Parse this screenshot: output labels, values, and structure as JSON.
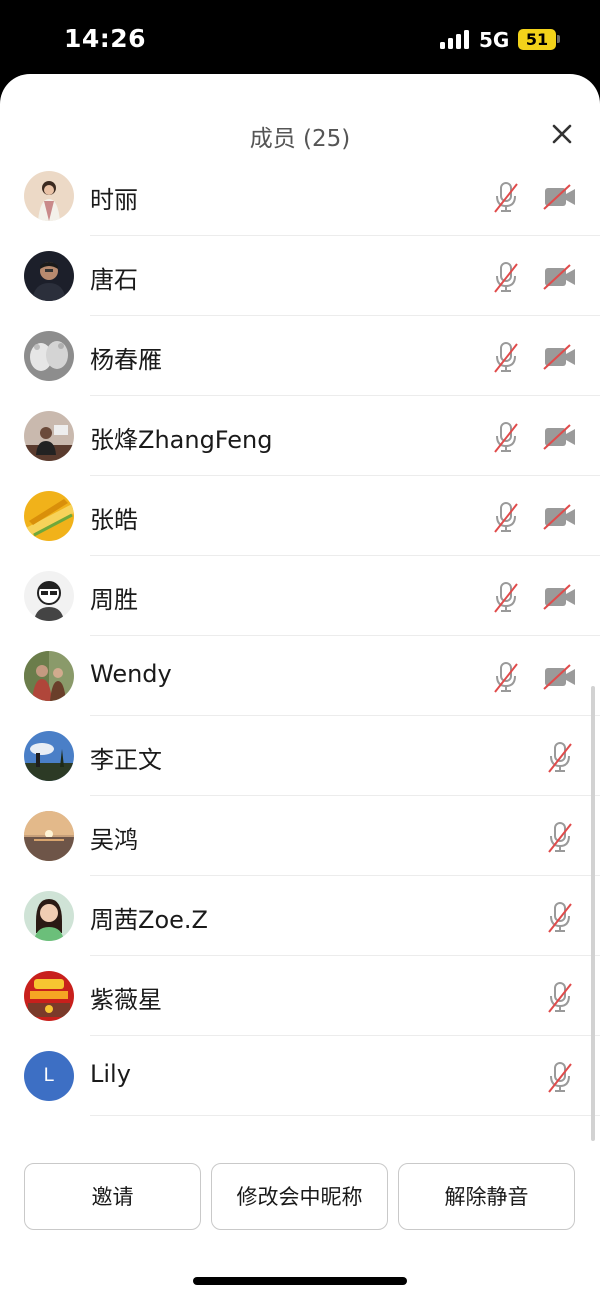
{
  "status_bar": {
    "time": "14:26",
    "network": "5G",
    "battery": "51"
  },
  "sheet": {
    "title": "成员 (25)",
    "close_icon": "close-icon"
  },
  "members": [
    {
      "name": "时丽",
      "avatar_style": "photo",
      "mic": "muted",
      "camera": "off"
    },
    {
      "name": "唐石",
      "avatar_style": "photo",
      "mic": "muted",
      "camera": "off"
    },
    {
      "name": "杨春雁",
      "avatar_style": "photo",
      "mic": "muted",
      "camera": "off"
    },
    {
      "name": "张烽ZhangFeng",
      "avatar_style": "photo",
      "mic": "muted",
      "camera": "off"
    },
    {
      "name": "张皓",
      "avatar_style": "photo",
      "mic": "muted",
      "camera": "off"
    },
    {
      "name": "周胜",
      "avatar_style": "photo",
      "mic": "muted",
      "camera": "off"
    },
    {
      "name": "Wendy",
      "avatar_style": "photo",
      "mic": "muted",
      "camera": "off"
    },
    {
      "name": "李正文",
      "avatar_style": "photo",
      "mic": "muted"
    },
    {
      "name": "吴鸿",
      "avatar_style": "photo",
      "mic": "muted"
    },
    {
      "name": "周茜Zoe.Z",
      "avatar_style": "photo",
      "mic": "muted"
    },
    {
      "name": "紫薇星",
      "avatar_style": "photo",
      "mic": "muted"
    },
    {
      "name": "Lily",
      "avatar_style": "initial",
      "avatar_letter": "L",
      "mic": "muted"
    }
  ],
  "actions": {
    "invite": "邀请",
    "rename": "修改会中昵称",
    "unmute": "解除静音"
  },
  "colors": {
    "muted_slash": "#e04b4b",
    "icon_gray": "#9a9a9a",
    "lily_avatar": "#3d6fc4",
    "battery": "#f2d21a"
  }
}
